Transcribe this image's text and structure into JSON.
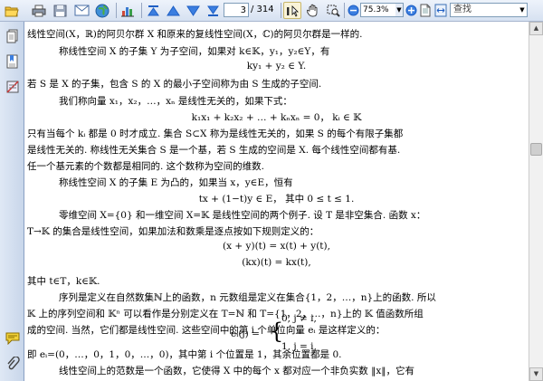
{
  "toolbar": {
    "page_current": "3",
    "page_total": "/ 314",
    "zoom": "75.3%",
    "search_placeholder": "查找"
  },
  "document": {
    "lines": [
      "线性空间(X，ℝ)的阿贝尔群 X 和原来的复线性空间(X，ℂ)的阿贝尔群是一样的.",
      "称线性空间 X 的子集 Y 为子空间，如果对 k∈𝕂，y₁，y₂∈Y，有",
      "ky₁ + y₂ ∈ Y.",
      "若 S 是 X 的子集，包含 S 的 X 的最小子空间称为由 S 生成的子空间.",
      "我们称向量 x₁，x₂，…，xₙ 是线性无关的，如果下式：",
      "k₁x₁ + k₂x₂ + … + kₙxₙ = 0，  kᵢ ∈ 𝕂",
      "只有当每个 kᵢ 都是 0 时才成立. 集合 S⊂X 称为是线性无关的，如果 S 的每个有限子集都",
      "是线性无关的. 称线性无关集合 S 是一个基，若 S 生成的空间是 X. 每个线性空间都有基.",
      "任一个基元素的个数都是相同的. 这个数称为空间的维数.",
      "称线性空间 X 的子集 E 为凸的，如果当 x，y∈E，恒有",
      "tx + (1−t)y ∈ E，  其中  0 ≤ t ≤ 1.",
      "零维空间 X={0} 和一维空间 X=𝕂 是线性空间的两个例子. 设 T 是非空集合. 函数 x：",
      "T→𝕂 的集合是线性空间，如果加法和数乘是逐点按如下规则定义的：",
      "(x + y)(t) = x(t) + y(t),",
      "(kx)(t) = kx(t),",
      "其中 t∈T，k∈𝕂.",
      "序列是定义在自然数集ℕ上的函数，n 元数组是定义在集合{1，2，…，n}上的函数. 所以",
      "𝕂 上的序列空间和 𝕂ⁿ 可以看作是分别定义在 T=ℕ 和 T={1，2，…，n}上的 𝕂 值函数所组",
      "成的空间. 当然，它们都是线性空间. 这些空间中的第 i 个单位向量 eᵢ 是这样定义的：",
      "0,  j ≠ i,",
      "eᵢ(j) =",
      "1,  j = i,",
      "即 eᵢ=(0，…，0，1，0，…，0)，其中第 i 个位置是 1，其余位置都是 0.",
      "线性空间上的范数是一个函数，它使得 X 中的每个 x 都对应一个非负实数 ‖x‖，它有"
    ]
  }
}
